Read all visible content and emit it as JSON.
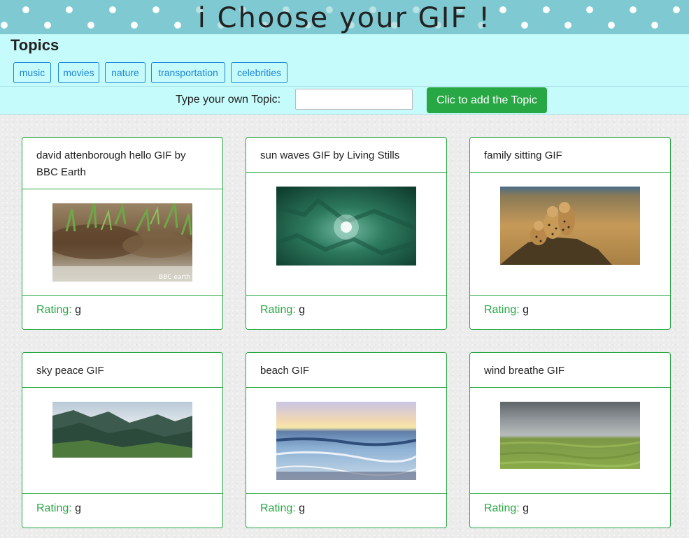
{
  "banner": {
    "title": "i Choose your GIF !"
  },
  "topics": {
    "heading": "Topics",
    "items": [
      "music",
      "movies",
      "nature",
      "transportation",
      "celebrities"
    ]
  },
  "add_topic": {
    "label": "Type your own Topic:",
    "input_value": "",
    "button_label": "Clic to add the Topic"
  },
  "gifs": [
    {
      "title": "david attenborough hello GIF by BBC Earth",
      "rating_label": "Rating:",
      "rating": " g",
      "watermark": "BBC earth"
    },
    {
      "title": "sun waves GIF by Living Stills",
      "rating_label": "Rating:",
      "rating": " g"
    },
    {
      "title": "family sitting GIF",
      "rating_label": "Rating:",
      "rating": " g"
    },
    {
      "title": "sky peace GIF",
      "rating_label": "Rating:",
      "rating": " g"
    },
    {
      "title": "beach GIF",
      "rating_label": "Rating:",
      "rating": " g"
    },
    {
      "title": "wind breathe GIF",
      "rating_label": "Rating:",
      "rating": " g"
    }
  ],
  "colors": {
    "banner": "#7fcad2",
    "topics_bg": "#c5fbfb",
    "primary_outline": "#1d84d6",
    "success": "#28a745"
  }
}
